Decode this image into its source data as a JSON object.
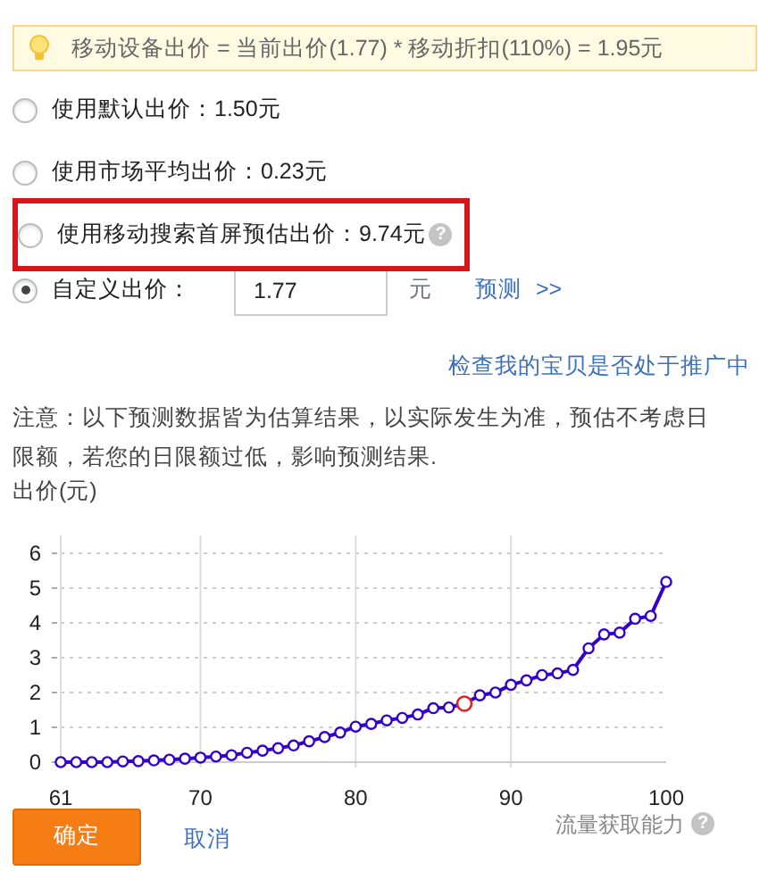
{
  "notice": {
    "text": "移动设备出价 = 当前出价(1.77) * 移动折扣(110%) = 1.95元"
  },
  "options": [
    {
      "kind": "plain",
      "label": "使用默认出价：1.50元",
      "selected": false,
      "highlighted": false
    },
    {
      "kind": "plain",
      "label": "使用市场平均出价：0.23元",
      "selected": false,
      "highlighted": false
    },
    {
      "kind": "plain",
      "label": "使用移动搜索首屏预估出价：9.74元",
      "selected": false,
      "highlighted": true,
      "help_mark": "?"
    },
    {
      "kind": "custom",
      "label": "自定义出价：",
      "selected": true,
      "highlighted": false,
      "value": "1.77",
      "unit": "元",
      "link": "预测",
      "link_arrow": ">>"
    }
  ],
  "check_link": "检查我的宝贝是否处于推广中",
  "note": "注意：以下预测数据皆为估算结果，以实际发生为准，预估不考虑日限额，若您的日限额过低，影响预测结果.",
  "chart": {
    "xlabel_help_mark": "?",
    "chart_data": {
      "type": "line",
      "ylabel": "出价(元)",
      "xlabel": "流量获取能力",
      "grid": true,
      "x": [
        61,
        62,
        63,
        64,
        65,
        66,
        67,
        68,
        69,
        70,
        71,
        72,
        73,
        74,
        75,
        76,
        77,
        78,
        79,
        80,
        81,
        82,
        83,
        84,
        85,
        86,
        87,
        88,
        89,
        90,
        91,
        92,
        93,
        94,
        95,
        96,
        97,
        98,
        99,
        100
      ],
      "series": [
        {
          "color": "#3300cc",
          "marker": "circle",
          "values": [
            0,
            0,
            0,
            0,
            0.02,
            0.03,
            0.05,
            0.07,
            0.1,
            0.13,
            0.16,
            0.2,
            0.27,
            0.33,
            0.4,
            0.48,
            0.6,
            0.72,
            0.85,
            1.02,
            1.1,
            1.2,
            1.27,
            1.37,
            1.55,
            1.57,
            1.68,
            1.92,
            2.0,
            2.22,
            2.35,
            2.5,
            2.55,
            2.65,
            3.27,
            3.67,
            3.72,
            4.12,
            4.2,
            5.18
          ]
        }
      ],
      "xlim": [
        61,
        100
      ],
      "ylim": [
        0,
        6
      ],
      "xticks": [
        61,
        70,
        80,
        90,
        100
      ],
      "yticks": [
        0,
        1,
        2,
        3,
        4,
        5,
        6
      ]
    }
  },
  "buttons": [
    {
      "kind": "primary",
      "label": "确定"
    },
    {
      "kind": "link",
      "label": "取消"
    }
  ]
}
